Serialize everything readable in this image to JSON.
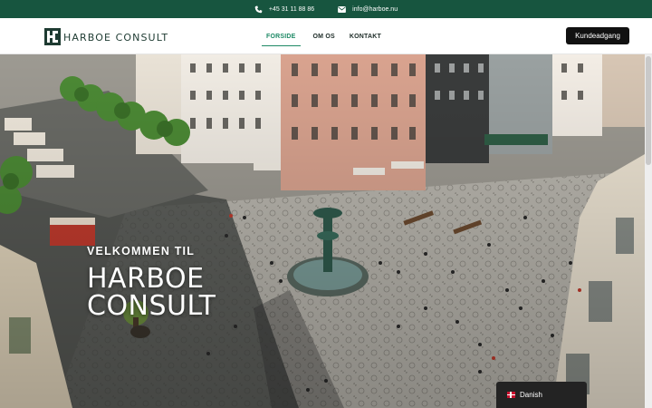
{
  "topbar": {
    "phone": "+45 31 11 88 86",
    "phone_icon": "phone-icon",
    "email": "info@harboe.nu",
    "email_icon": "envelope-icon",
    "background": "#17553f"
  },
  "header": {
    "logo_text": "HARBOE CONSULT",
    "nav": [
      {
        "label": "FORSIDE",
        "active": true
      },
      {
        "label": "OM OS",
        "active": false
      },
      {
        "label": "KONTAKT",
        "active": false
      }
    ],
    "cta_label": "Kundeadgang",
    "accent": "#1f8a66"
  },
  "hero": {
    "subtitle": "VELKOMMEN TIL",
    "title": "HARBOE CONSULT"
  },
  "language": {
    "label": "Danish",
    "flag": "danish-flag-icon"
  }
}
